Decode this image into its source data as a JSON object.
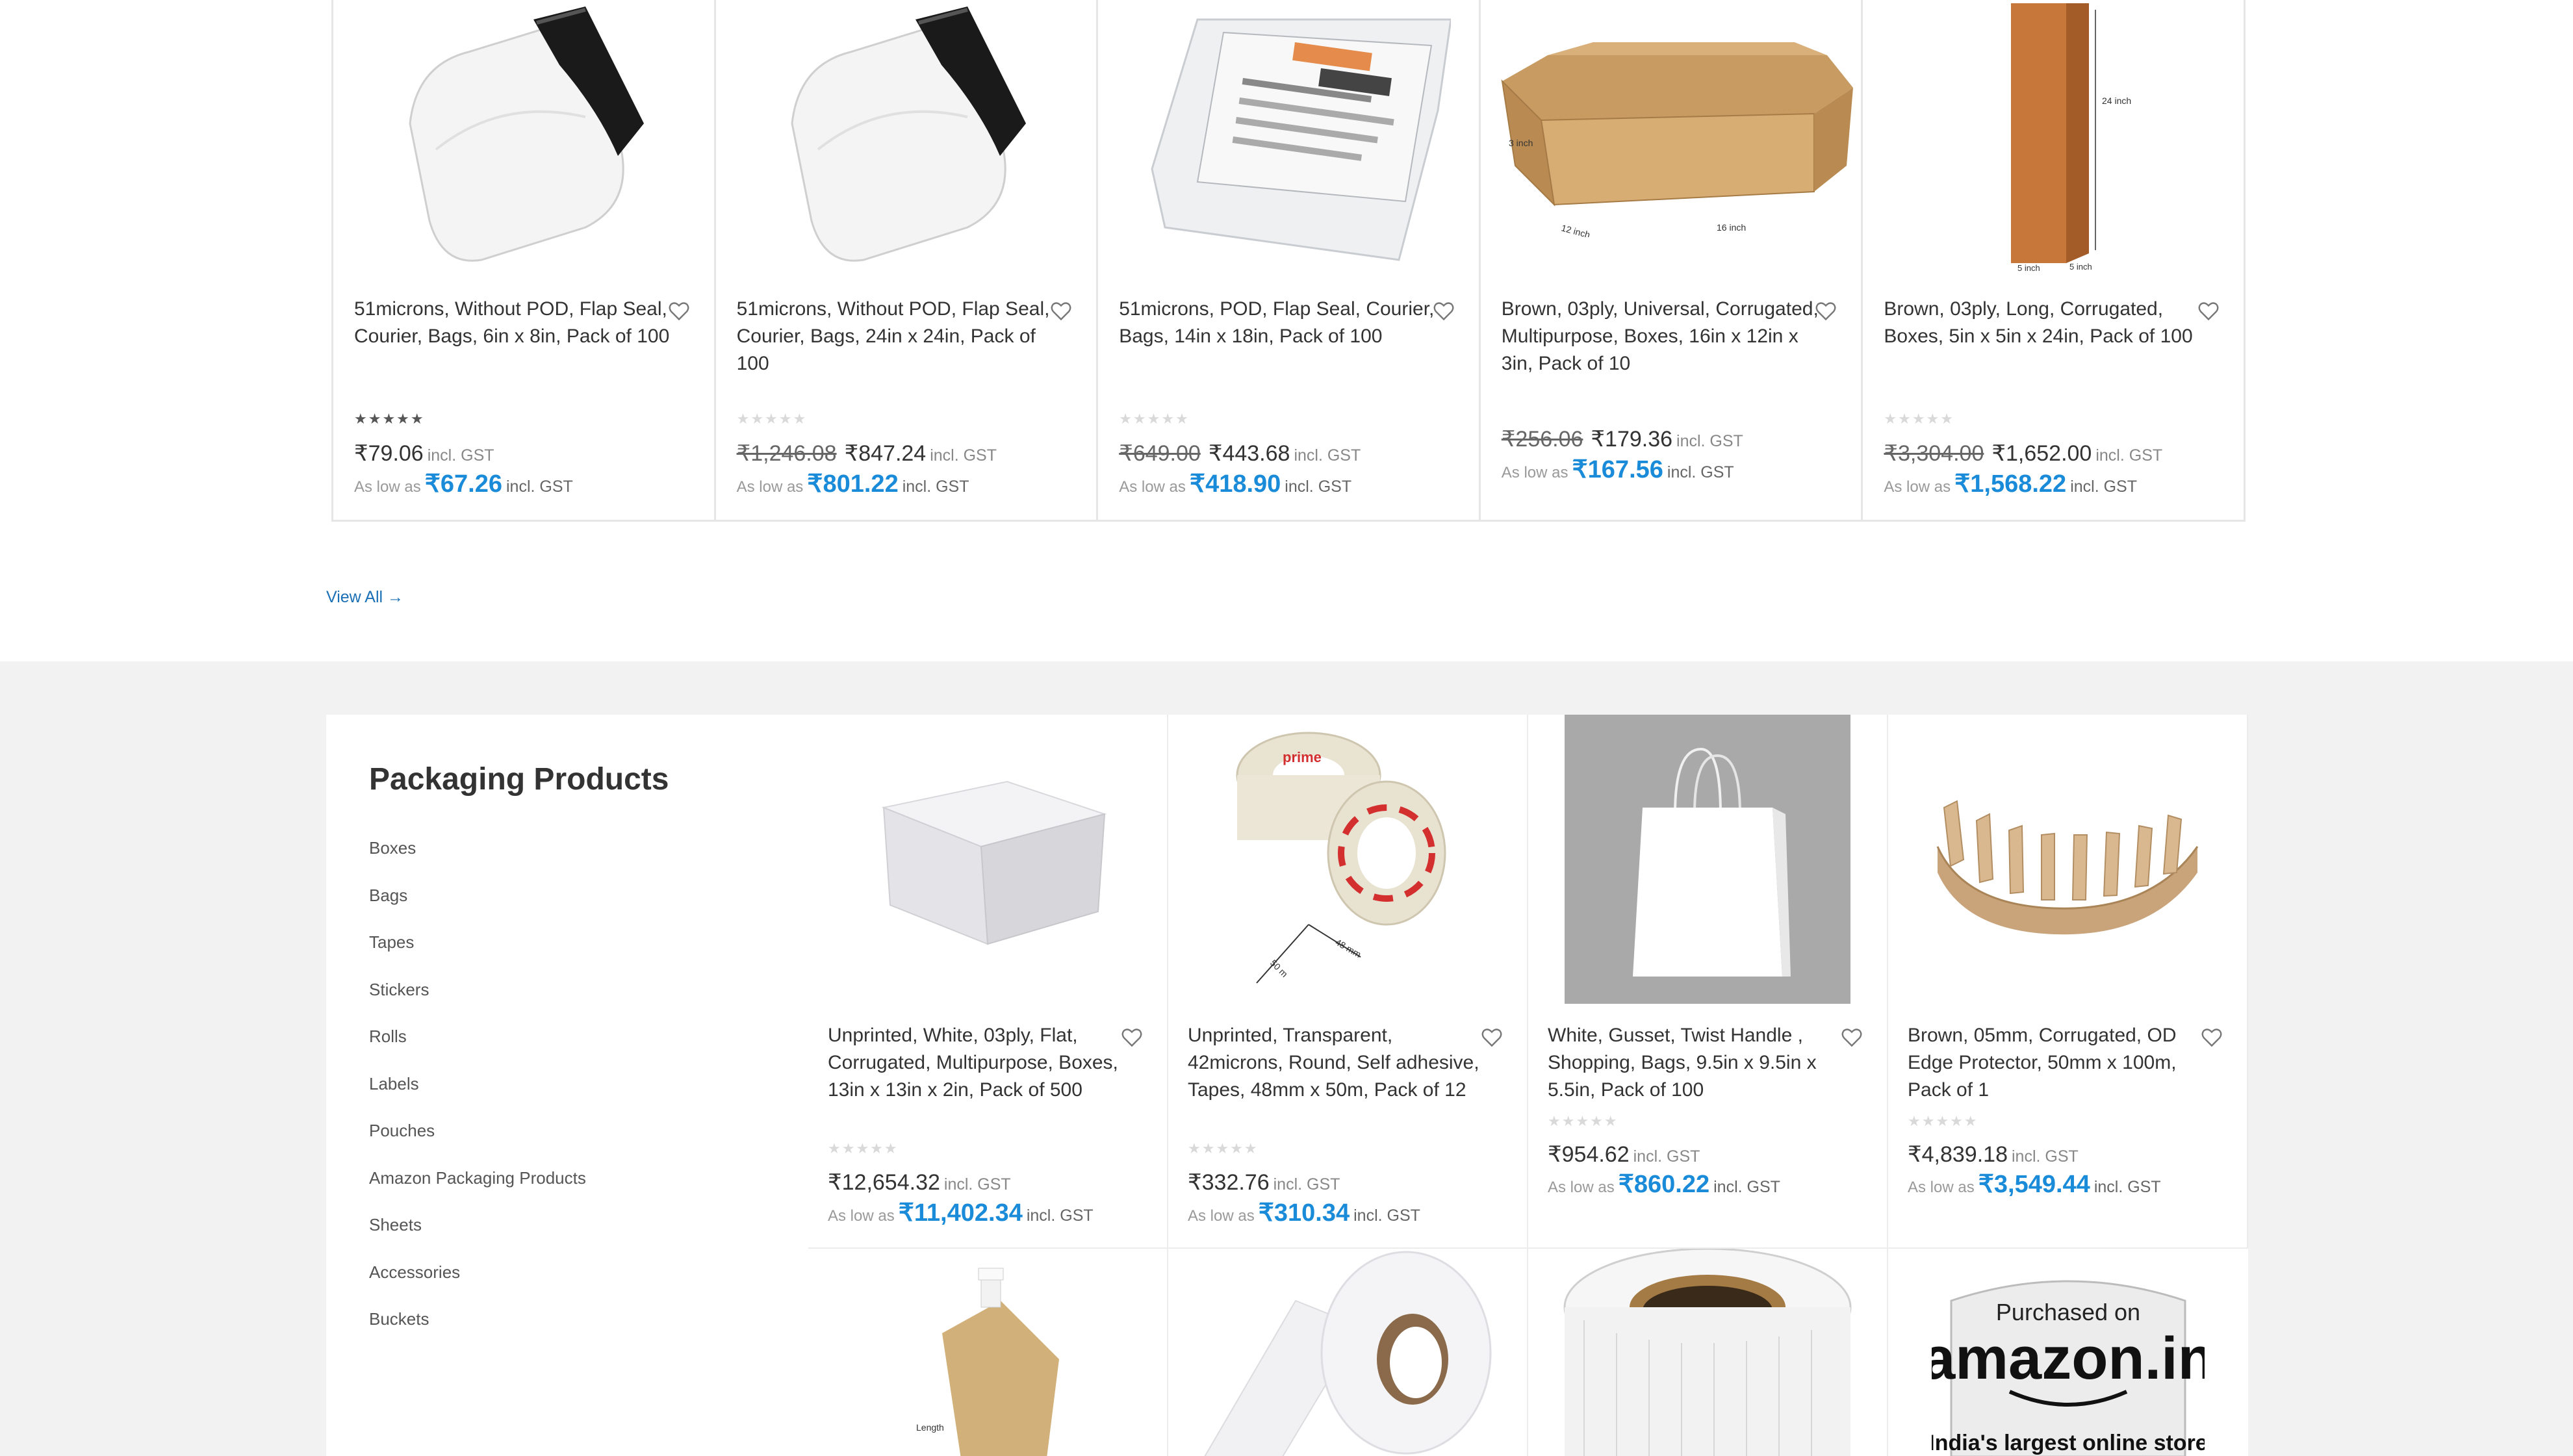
{
  "top_products": [
    {
      "title": "51microns, Without POD, Flap Seal, Courier, Bags, 6in x 8in, Pack of 100",
      "rating": 5,
      "old_price": "",
      "price": "₹79.06",
      "gst": "incl. GST",
      "low_label": "As low as",
      "low_price": "₹67.26",
      "low_gst": "incl. GST",
      "image": "white-courier-bag"
    },
    {
      "title": "51microns, Without POD, Flap Seal, Courier, Bags, 24in x 24in, Pack of 100",
      "rating": 0,
      "old_price": "₹1,246.08",
      "price": "₹847.24",
      "gst": "incl. GST",
      "low_label": "As low as",
      "low_price": "₹801.22",
      "low_gst": "incl. GST",
      "image": "white-courier-bag"
    },
    {
      "title": "51microns, POD, Flap Seal, Courier, Bags, 14in x 18in, Pack of 100",
      "rating": 0,
      "old_price": "₹649.00",
      "price": "₹443.68",
      "gst": "incl. GST",
      "low_label": "As low as",
      "low_price": "₹418.90",
      "low_gst": "incl. GST",
      "image": "pod-courier-bag"
    },
    {
      "title": "Brown, 03ply, Universal, Corrugated, Multipurpose, Boxes, 16in x 12in x 3in, Pack of 10",
      "rating": null,
      "old_price": "₹256.06",
      "price": "₹179.36",
      "gst": "incl. GST",
      "low_label": "As low as",
      "low_price": "₹167.56",
      "low_gst": "incl. GST",
      "image": "open-brown-box",
      "dims": [
        "3 inch",
        "12 inch",
        "16 inch"
      ]
    },
    {
      "title": "Brown, 03ply, Long, Corrugated, Boxes, 5in x 5in x 24in, Pack of 100",
      "rating": 0,
      "old_price": "₹3,304.00",
      "price": "₹1,652.00",
      "gst": "incl. GST",
      "low_label": "As low as",
      "low_price": "₹1,568.22",
      "low_gst": "incl. GST",
      "image": "tall-brown-box",
      "dims": [
        "24 inch",
        "5 inch",
        "5 inch"
      ]
    }
  ],
  "view_all": "View All →",
  "sidebar": {
    "heading": "Packaging Products",
    "items": [
      "Boxes",
      "Bags",
      "Tapes",
      "Stickers",
      "Rolls",
      "Labels",
      "Pouches",
      "Amazon Packaging Products",
      "Sheets",
      "Accessories",
      "Buckets"
    ]
  },
  "grid_products": [
    {
      "title": "Unprinted, White, 03ply, Flat, Corrugated, Multipurpose, Boxes, 13in x 13in x 2in, Pack of 500",
      "rating": 0,
      "price": "₹12,654.32",
      "gst": "incl. GST",
      "low_label": "As low as",
      "low_price": "₹11,402.34",
      "low_gst": "incl. GST",
      "image": "white-box"
    },
    {
      "title": "Unprinted, Transparent, 42microns, Round, Self adhesive, Tapes, 48mm x 50m, Pack of 12",
      "rating": 0,
      "price": "₹332.76",
      "gst": "incl. GST",
      "low_label": "As low as",
      "low_price": "₹310.34",
      "low_gst": "incl. GST",
      "image": "tape-rolls",
      "tape_text": "prime",
      "dims": [
        "48 mm",
        "50 m"
      ]
    },
    {
      "title": "White, Gusset, Twist Handle , Shopping, Bags, 9.5in x 9.5in x 5.5in, Pack of 100",
      "rating": 0,
      "price": "₹954.62",
      "gst": "incl. GST",
      "low_label": "As low as",
      "low_price": "₹860.22",
      "low_gst": "incl. GST",
      "image": "white-shopping-bag"
    },
    {
      "title": "Brown, 05mm, Corrugated, OD Edge Protector, 50mm x 100m, Pack of 1",
      "rating": 0,
      "price": "₹4,839.18",
      "gst": "incl. GST",
      "low_label": "As low as",
      "low_price": "₹3,549.44",
      "low_gst": "incl. GST",
      "image": "edge-protector"
    },
    {
      "image": "spout-pouch",
      "image_text": "Length"
    },
    {
      "image": "label-roll"
    },
    {
      "image": "strapping-roll"
    },
    {
      "image": "amazon-tape",
      "image_text": [
        "Purchased on",
        "amazon.in",
        "India's largest online store"
      ]
    }
  ]
}
